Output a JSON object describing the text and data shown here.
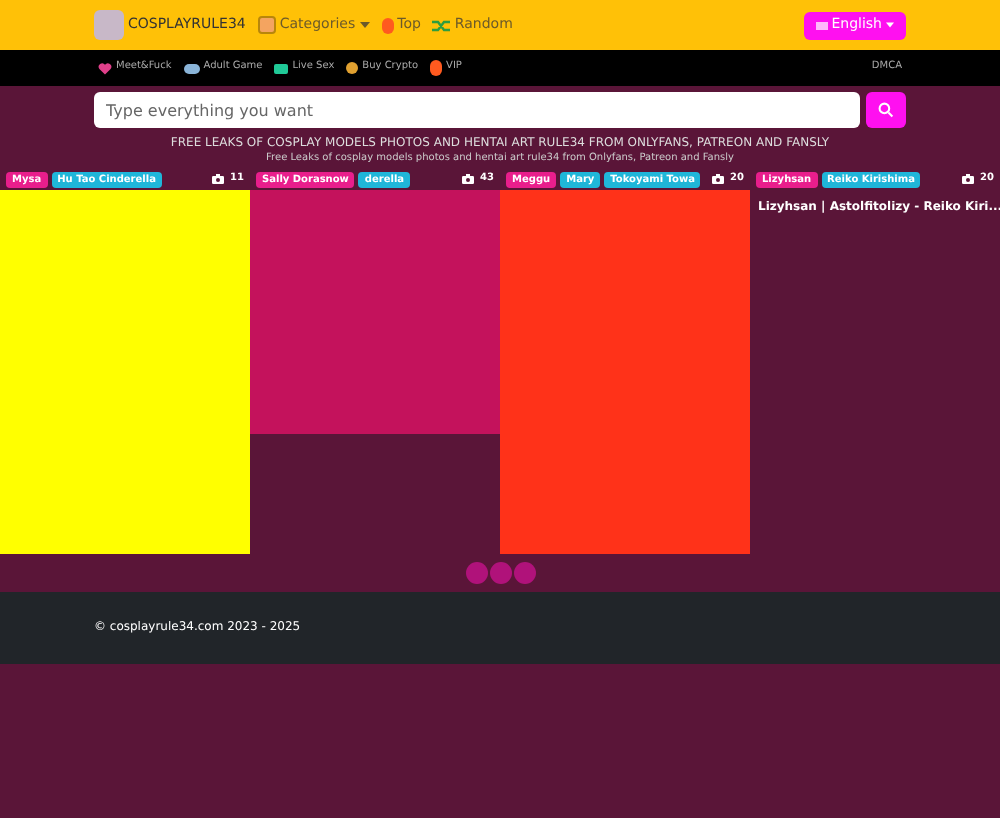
{
  "header": {
    "brand": "COSPLAYRULE34",
    "nav": [
      {
        "label": "Categories",
        "kind": "dropdown"
      },
      {
        "label": "Top",
        "kind": "fire"
      },
      {
        "label": "Random",
        "kind": "shuffle"
      }
    ],
    "language": "English"
  },
  "subnav": {
    "links": [
      {
        "label": "Meet&Fuck",
        "kind": "heart"
      },
      {
        "label": "Adult Game",
        "kind": "game"
      },
      {
        "label": "Live Sex",
        "kind": "live"
      },
      {
        "label": "Buy Crypto",
        "kind": "coin"
      },
      {
        "label": "VIP",
        "kind": "fire"
      }
    ],
    "right": "DMCA"
  },
  "search": {
    "placeholder": "Type everything you want"
  },
  "heading": "FREE LEAKS OF COSPLAY MODELS PHOTOS AND HENTAI ART RULE34 FROM ONLYFANS, PATREON AND FANSLY",
  "subheading": "Free Leaks of cosplay models photos and hentai art rule34 from Onlyfans, Patreon and Fansly",
  "cards": [
    {
      "models": [
        "Mysa"
      ],
      "characters": [
        "Hu Tao Cinderella"
      ],
      "count": "11",
      "kind": "full",
      "color": "#ffff00"
    },
    {
      "models": [
        "Sally Dorasnow"
      ],
      "characters": [
        "derella"
      ],
      "count": "43",
      "kind": "short",
      "color": "#c4125c"
    },
    {
      "models": [
        "Meggu"
      ],
      "characters": [
        "Mary",
        "Tokoyami Towa"
      ],
      "count": "20",
      "kind": "full",
      "color": "#ff3219"
    },
    {
      "models": [
        "Lizyhsan"
      ],
      "characters": [
        "Reiko Kirishima"
      ],
      "count": "20",
      "kind": "title",
      "title": "Lizyhsan | Astolfitolizy - Reiko Kiri..."
    }
  ],
  "pagination": [
    {
      "kind": "dot"
    },
    {
      "kind": "dot"
    },
    {
      "kind": "dot"
    }
  ],
  "footer": "© cosplayrule34.com 2023 - 2025"
}
